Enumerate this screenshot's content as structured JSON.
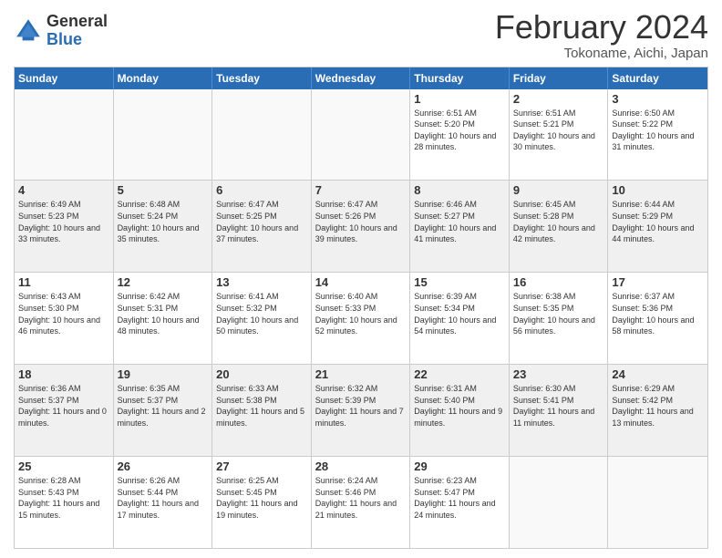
{
  "logo": {
    "general": "General",
    "blue": "Blue"
  },
  "title": "February 2024",
  "location": "Tokoname, Aichi, Japan",
  "days_of_week": [
    "Sunday",
    "Monday",
    "Tuesday",
    "Wednesday",
    "Thursday",
    "Friday",
    "Saturday"
  ],
  "weeks": [
    [
      {
        "day": "",
        "info": ""
      },
      {
        "day": "",
        "info": ""
      },
      {
        "day": "",
        "info": ""
      },
      {
        "day": "",
        "info": ""
      },
      {
        "day": "1",
        "info": "Sunrise: 6:51 AM\nSunset: 5:20 PM\nDaylight: 10 hours and 28 minutes."
      },
      {
        "day": "2",
        "info": "Sunrise: 6:51 AM\nSunset: 5:21 PM\nDaylight: 10 hours and 30 minutes."
      },
      {
        "day": "3",
        "info": "Sunrise: 6:50 AM\nSunset: 5:22 PM\nDaylight: 10 hours and 31 minutes."
      }
    ],
    [
      {
        "day": "4",
        "info": "Sunrise: 6:49 AM\nSunset: 5:23 PM\nDaylight: 10 hours and 33 minutes."
      },
      {
        "day": "5",
        "info": "Sunrise: 6:48 AM\nSunset: 5:24 PM\nDaylight: 10 hours and 35 minutes."
      },
      {
        "day": "6",
        "info": "Sunrise: 6:47 AM\nSunset: 5:25 PM\nDaylight: 10 hours and 37 minutes."
      },
      {
        "day": "7",
        "info": "Sunrise: 6:47 AM\nSunset: 5:26 PM\nDaylight: 10 hours and 39 minutes."
      },
      {
        "day": "8",
        "info": "Sunrise: 6:46 AM\nSunset: 5:27 PM\nDaylight: 10 hours and 41 minutes."
      },
      {
        "day": "9",
        "info": "Sunrise: 6:45 AM\nSunset: 5:28 PM\nDaylight: 10 hours and 42 minutes."
      },
      {
        "day": "10",
        "info": "Sunrise: 6:44 AM\nSunset: 5:29 PM\nDaylight: 10 hours and 44 minutes."
      }
    ],
    [
      {
        "day": "11",
        "info": "Sunrise: 6:43 AM\nSunset: 5:30 PM\nDaylight: 10 hours and 46 minutes."
      },
      {
        "day": "12",
        "info": "Sunrise: 6:42 AM\nSunset: 5:31 PM\nDaylight: 10 hours and 48 minutes."
      },
      {
        "day": "13",
        "info": "Sunrise: 6:41 AM\nSunset: 5:32 PM\nDaylight: 10 hours and 50 minutes."
      },
      {
        "day": "14",
        "info": "Sunrise: 6:40 AM\nSunset: 5:33 PM\nDaylight: 10 hours and 52 minutes."
      },
      {
        "day": "15",
        "info": "Sunrise: 6:39 AM\nSunset: 5:34 PM\nDaylight: 10 hours and 54 minutes."
      },
      {
        "day": "16",
        "info": "Sunrise: 6:38 AM\nSunset: 5:35 PM\nDaylight: 10 hours and 56 minutes."
      },
      {
        "day": "17",
        "info": "Sunrise: 6:37 AM\nSunset: 5:36 PM\nDaylight: 10 hours and 58 minutes."
      }
    ],
    [
      {
        "day": "18",
        "info": "Sunrise: 6:36 AM\nSunset: 5:37 PM\nDaylight: 11 hours and 0 minutes."
      },
      {
        "day": "19",
        "info": "Sunrise: 6:35 AM\nSunset: 5:37 PM\nDaylight: 11 hours and 2 minutes."
      },
      {
        "day": "20",
        "info": "Sunrise: 6:33 AM\nSunset: 5:38 PM\nDaylight: 11 hours and 5 minutes."
      },
      {
        "day": "21",
        "info": "Sunrise: 6:32 AM\nSunset: 5:39 PM\nDaylight: 11 hours and 7 minutes."
      },
      {
        "day": "22",
        "info": "Sunrise: 6:31 AM\nSunset: 5:40 PM\nDaylight: 11 hours and 9 minutes."
      },
      {
        "day": "23",
        "info": "Sunrise: 6:30 AM\nSunset: 5:41 PM\nDaylight: 11 hours and 11 minutes."
      },
      {
        "day": "24",
        "info": "Sunrise: 6:29 AM\nSunset: 5:42 PM\nDaylight: 11 hours and 13 minutes."
      }
    ],
    [
      {
        "day": "25",
        "info": "Sunrise: 6:28 AM\nSunset: 5:43 PM\nDaylight: 11 hours and 15 minutes."
      },
      {
        "day": "26",
        "info": "Sunrise: 6:26 AM\nSunset: 5:44 PM\nDaylight: 11 hours and 17 minutes."
      },
      {
        "day": "27",
        "info": "Sunrise: 6:25 AM\nSunset: 5:45 PM\nDaylight: 11 hours and 19 minutes."
      },
      {
        "day": "28",
        "info": "Sunrise: 6:24 AM\nSunset: 5:46 PM\nDaylight: 11 hours and 21 minutes."
      },
      {
        "day": "29",
        "info": "Sunrise: 6:23 AM\nSunset: 5:47 PM\nDaylight: 11 hours and 24 minutes."
      },
      {
        "day": "",
        "info": ""
      },
      {
        "day": "",
        "info": ""
      }
    ]
  ]
}
